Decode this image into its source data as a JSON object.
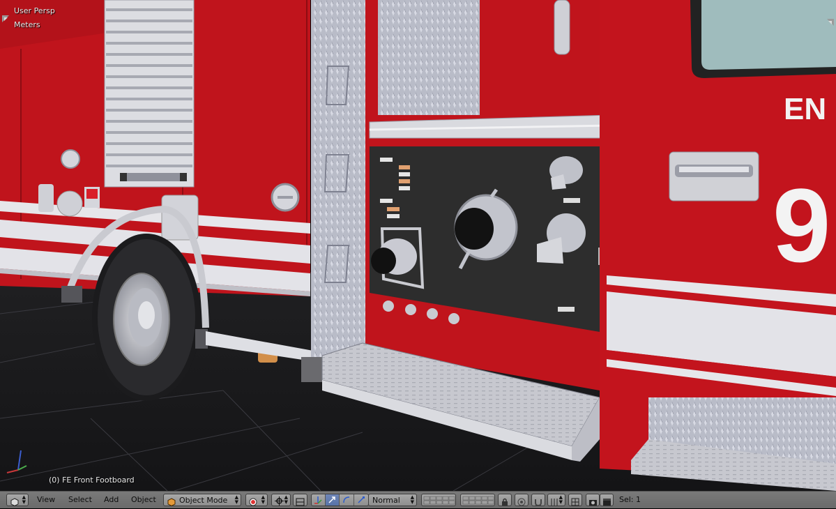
{
  "viewport": {
    "view_name": "User Persp",
    "units": "Meters",
    "selected_object": "(0) FE Front Footboard",
    "truck_lettering": "EN",
    "truck_number": "9"
  },
  "header": {
    "menus": [
      "View",
      "Select",
      "Add",
      "Object"
    ],
    "mode": "Object Mode",
    "transform_orientation": "Normal",
    "selection_info": "Sel: 1"
  },
  "icons": {
    "editor_type": "3d-view-cube-icon",
    "mode": "object-mode-cube-icon",
    "shading": "viewport-shading-icon",
    "pivot": "pivot-point-icon",
    "manipulator": "transform-manipulator-icon",
    "translate": "translate-arrow-icon",
    "rotate": "rotate-arc-icon",
    "scale": "scale-icon",
    "layers": "layer-grid-icon",
    "proportional": "proportional-edit-icon",
    "snap": "snap-magnet-icon",
    "render": "render-camera-icon",
    "corner": "viewport-corner-icon"
  },
  "colors": {
    "truck_red": "#c0141c",
    "header_bg": "#727272",
    "active_blue": "#5873a8",
    "panel_dark": "#2d2d2d"
  }
}
